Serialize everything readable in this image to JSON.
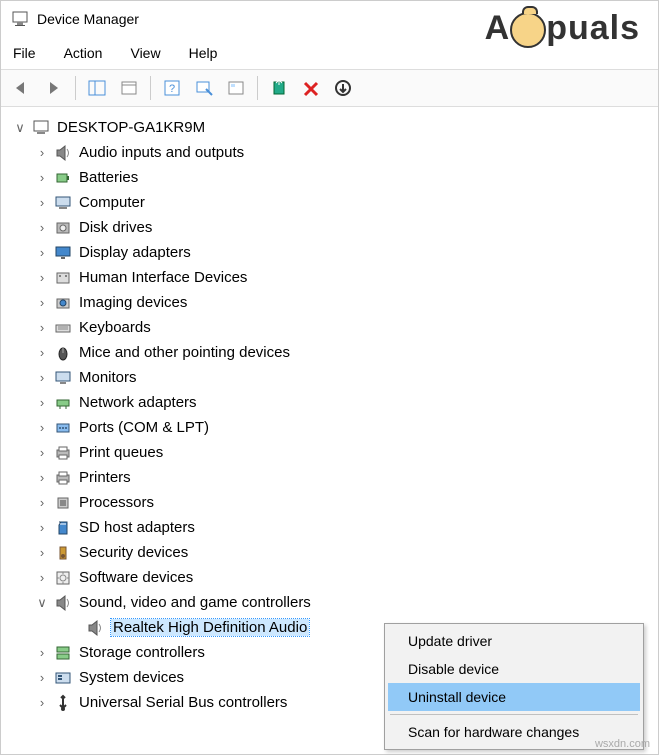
{
  "window": {
    "title": "Device Manager"
  },
  "menu": {
    "file": "File",
    "action": "Action",
    "view": "View",
    "help": "Help"
  },
  "tree": {
    "root": "DESKTOP-GA1KR9M",
    "items": [
      {
        "label": "Audio inputs and outputs",
        "icon": "speaker-icon"
      },
      {
        "label": "Batteries",
        "icon": "battery-icon"
      },
      {
        "label": "Computer",
        "icon": "computer-icon"
      },
      {
        "label": "Disk drives",
        "icon": "disk-icon"
      },
      {
        "label": "Display adapters",
        "icon": "display-icon"
      },
      {
        "label": "Human Interface Devices",
        "icon": "hid-icon"
      },
      {
        "label": "Imaging devices",
        "icon": "camera-icon"
      },
      {
        "label": "Keyboards",
        "icon": "keyboard-icon"
      },
      {
        "label": "Mice and other pointing devices",
        "icon": "mouse-icon"
      },
      {
        "label": "Monitors",
        "icon": "monitor-icon"
      },
      {
        "label": "Network adapters",
        "icon": "network-icon"
      },
      {
        "label": "Ports (COM & LPT)",
        "icon": "port-icon"
      },
      {
        "label": "Print queues",
        "icon": "printer-icon"
      },
      {
        "label": "Printers",
        "icon": "printer-icon"
      },
      {
        "label": "Processors",
        "icon": "cpu-icon"
      },
      {
        "label": "SD host adapters",
        "icon": "sd-icon"
      },
      {
        "label": "Security devices",
        "icon": "security-icon"
      },
      {
        "label": "Software devices",
        "icon": "software-icon"
      },
      {
        "label": "Sound, video and game controllers",
        "icon": "speaker-icon",
        "expanded": true,
        "children": [
          {
            "label": "Realtek High Definition Audio",
            "icon": "speaker-icon",
            "selected": true
          }
        ]
      },
      {
        "label": "Storage controllers",
        "icon": "storage-icon"
      },
      {
        "label": "System devices",
        "icon": "system-icon"
      },
      {
        "label": "Universal Serial Bus controllers",
        "icon": "usb-icon"
      }
    ]
  },
  "context_menu": {
    "update": "Update driver",
    "disable": "Disable device",
    "uninstall": "Uninstall device",
    "scan": "Scan for hardware changes"
  },
  "watermark": {
    "prefix": "A",
    "suffix": "puals"
  },
  "footer_url": "wsxdn.com"
}
